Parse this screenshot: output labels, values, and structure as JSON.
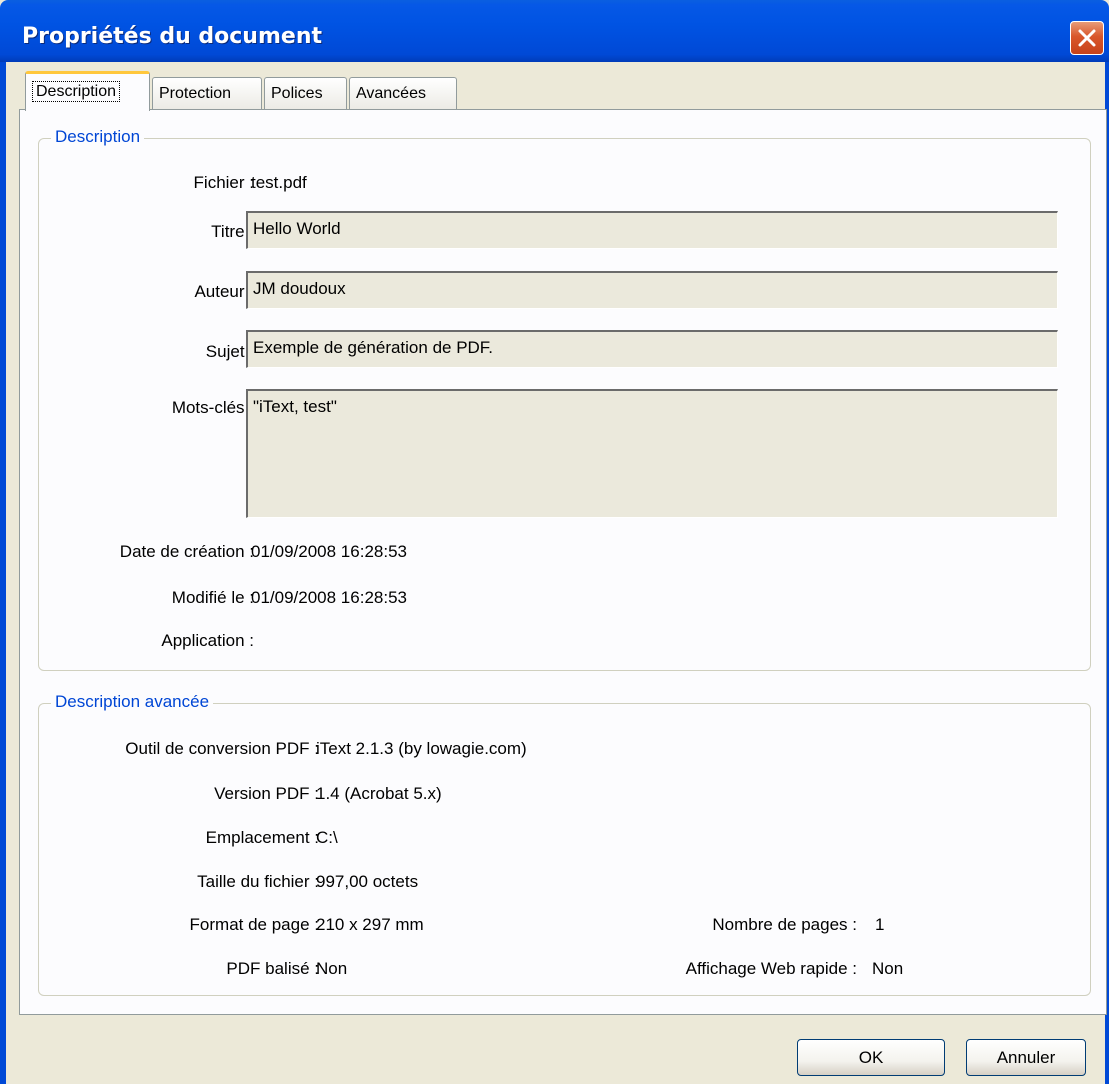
{
  "window": {
    "title": "Propriétés du document"
  },
  "tabs": [
    {
      "label": "Description"
    },
    {
      "label": "Protection"
    },
    {
      "label": "Polices"
    },
    {
      "label": "Avancées"
    }
  ],
  "description": {
    "group_title": "Description",
    "fichier_label": "Fichier :",
    "fichier_value": "test.pdf",
    "titre_label": "Titre :",
    "titre_value": "Hello World",
    "auteur_label": "Auteur :",
    "auteur_value": "JM doudoux",
    "sujet_label": "Sujet :",
    "sujet_value": "Exemple de génération de PDF.",
    "mots_cles_label": "Mots-clés :",
    "mots_cles_value": "\"iText, test\"",
    "date_creation_label": "Date de création :",
    "date_creation_value": "01/09/2008 16:28:53",
    "modifie_label": "Modifié le :",
    "modifie_value": "01/09/2008 16:28:53",
    "application_label": "Application :",
    "application_value": ""
  },
  "advanced": {
    "group_title": "Description avancée",
    "outil_label": "Outil de conversion PDF :",
    "outil_value": "iText 2.1.3 (by lowagie.com)",
    "version_label": "Version PDF :",
    "version_value": "1.4 (Acrobat 5.x)",
    "emplacement_label": "Emplacement :",
    "emplacement_value": "C:\\",
    "taille_label": "Taille du fichier :",
    "taille_value": "997,00 octets",
    "format_label": "Format de page :",
    "format_value": "210 x 297 mm",
    "nb_pages_label": "Nombre de pages :",
    "nb_pages_value": "1",
    "balise_label": "PDF balisé :",
    "balise_value": "Non",
    "web_label": "Affichage Web rapide :",
    "web_value": "Non"
  },
  "buttons": {
    "ok": "OK",
    "cancel": "Annuler"
  },
  "colors": {
    "titlebar": "#0053e3",
    "group_title": "#0046d5",
    "field_bg": "#ebe9dc",
    "window_bg": "#ece9d8"
  },
  "icons": {
    "close": "close-icon"
  }
}
